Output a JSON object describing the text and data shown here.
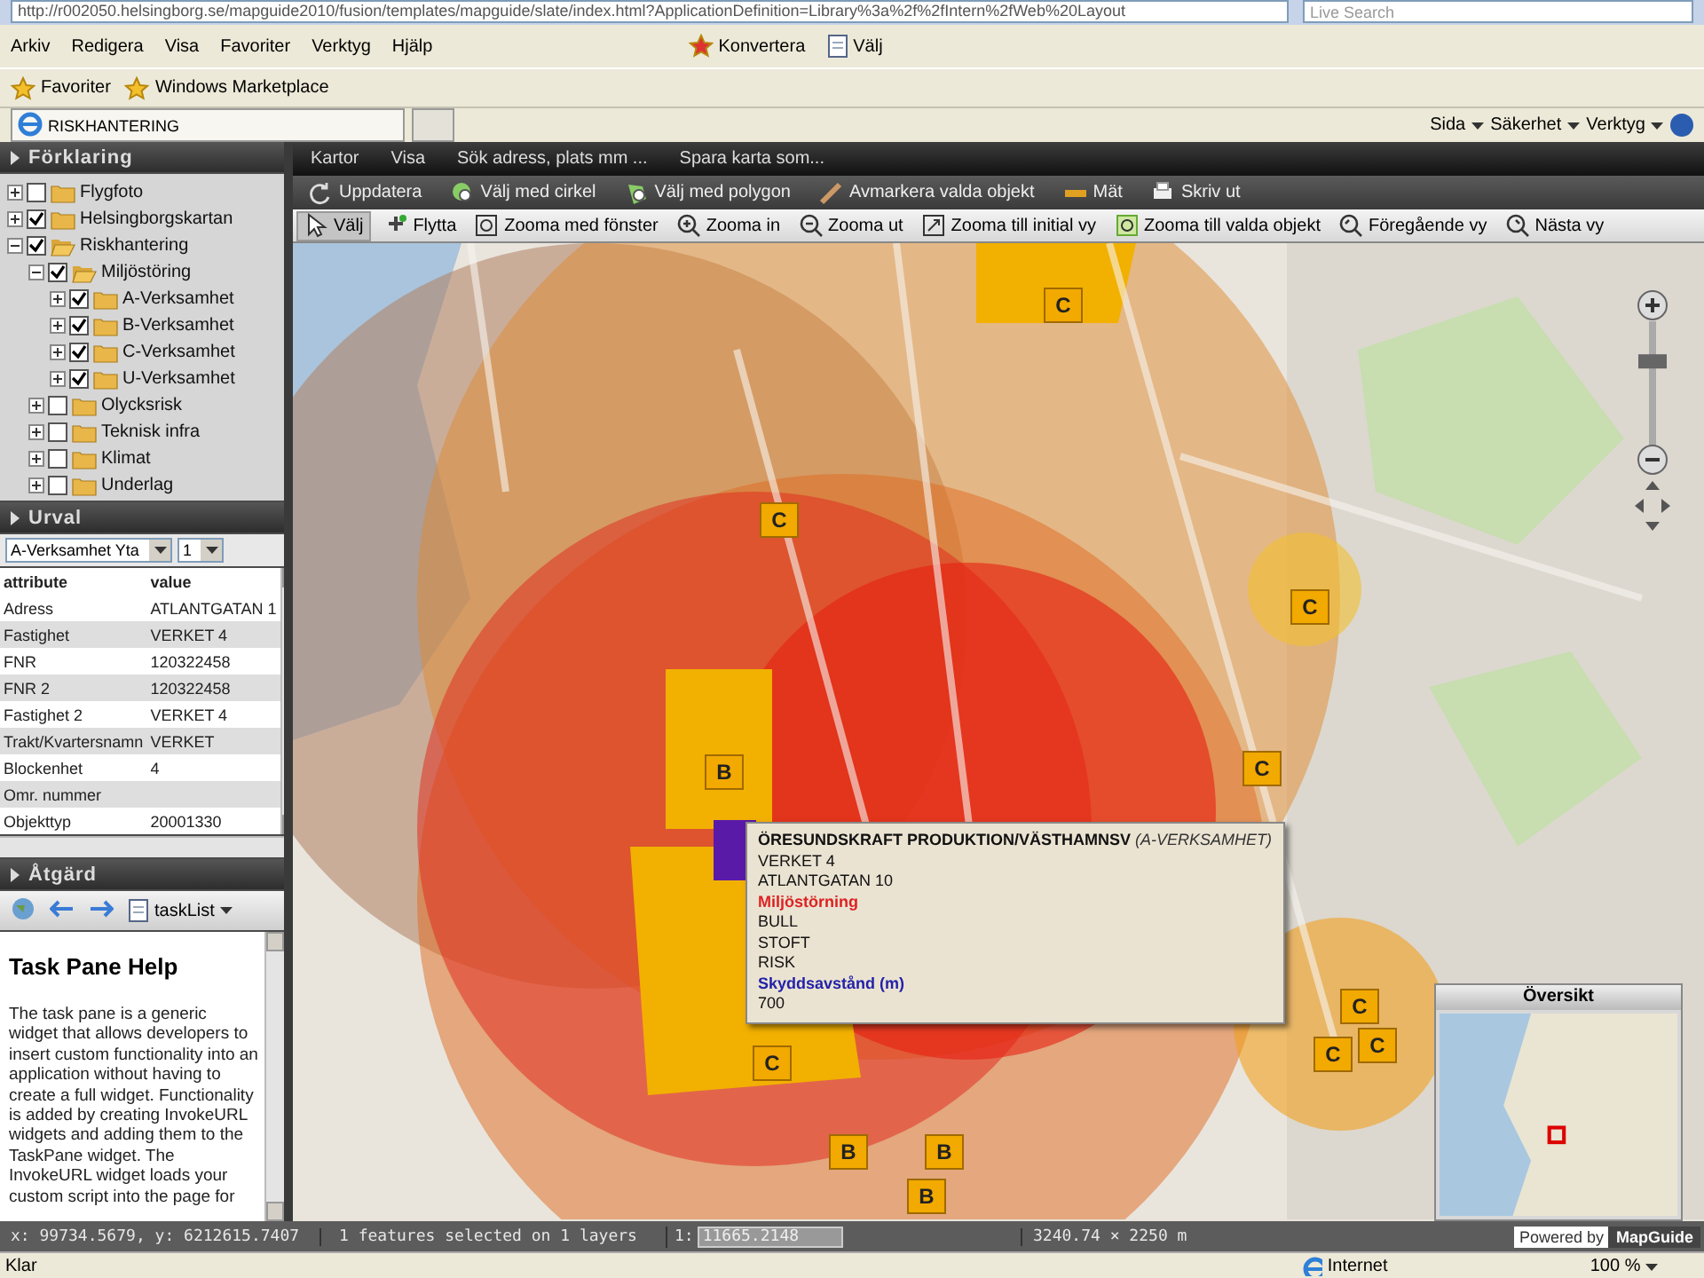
{
  "browser": {
    "address": "http://r002050.helsingborg.se/mapguide2010/fusion/templates/mapguide/slate/index.html?ApplicationDefinition=Library%3a%2f%2fIntern%2fWeb%20Layout",
    "search_placeholder": "Live Search",
    "menu": [
      "Arkiv",
      "Redigera",
      "Visa",
      "Favoriter",
      "Verktyg",
      "Hjälp"
    ],
    "tools": [
      "Konvertera",
      "Välj"
    ],
    "favorites": [
      "Favoriter",
      "Windows Marketplace"
    ],
    "tab": "RISKHANTERING",
    "commands": [
      "Sida",
      "Säkerhet",
      "Verktyg"
    ]
  },
  "legend": {
    "title": "Förklaring",
    "tree": [
      {
        "label": "Flygfoto",
        "checked": false,
        "expanded": false
      },
      {
        "label": "Helsingborgskartan",
        "checked": true,
        "expanded": false
      },
      {
        "label": "Riskhantering",
        "checked": true,
        "expanded": true,
        "children": [
          {
            "label": "Miljöstöring",
            "checked": true,
            "expanded": true,
            "children": [
              {
                "label": "A-Verksamhet",
                "checked": true,
                "expanded": false
              },
              {
                "label": "B-Verksamhet",
                "checked": true,
                "expanded": false
              },
              {
                "label": "C-Verksamhet",
                "checked": true,
                "expanded": false
              },
              {
                "label": "U-Verksamhet",
                "checked": true,
                "expanded": false
              }
            ]
          },
          {
            "label": "Olycksrisk",
            "checked": false,
            "expanded": false
          },
          {
            "label": "Teknisk infra",
            "checked": false,
            "expanded": false
          },
          {
            "label": "Klimat",
            "checked": false,
            "expanded": false
          },
          {
            "label": "Underlag",
            "checked": false,
            "expanded": false
          }
        ]
      }
    ]
  },
  "selection": {
    "title": "Urval",
    "layer": "A-Verksamhet Yta",
    "page": "1",
    "columns": [
      "attribute",
      "value"
    ],
    "rows": [
      [
        "Adress",
        "ATLANTGATAN 1"
      ],
      [
        "Fastighet",
        "VERKET 4"
      ],
      [
        "FNR",
        "120322458"
      ],
      [
        "FNR 2",
        "120322458"
      ],
      [
        "Fastighet 2",
        "VERKET 4"
      ],
      [
        "Trakt/Kvartersnamn",
        "VERKET"
      ],
      [
        "Blockenhet",
        "4"
      ],
      [
        "Omr. nummer",
        ""
      ],
      [
        "Objekttyp",
        "20001330"
      ]
    ]
  },
  "task": {
    "title": "Åtgärd",
    "list": "taskList",
    "heading": "Task Pane Help",
    "body": "The task pane is a generic widget that allows developers to insert custom functionality into an application without having to create a full widget. Functionality is added by creating InvokeURL widgets and adding them to the TaskPane widget. The InvokeURL widget loads your custom script into the page for"
  },
  "coordinates": "x: 99734.5679, y: 6212615.7407",
  "menubar": [
    "Kartor",
    "Visa",
    "Sök adress, plats mm ...",
    "Spara karta som..."
  ],
  "toolbar_1": [
    "Uppdatera",
    "Välj med cirkel",
    "Välj med polygon",
    "Avmarkera valda objekt",
    "Mät",
    "Skriv ut"
  ],
  "toolbar_2": [
    {
      "label": "Välj",
      "selected": true
    },
    {
      "label": "Flytta",
      "selected": false
    },
    {
      "label": "Zooma med fönster",
      "selected": false
    },
    {
      "label": "Zooma in",
      "selected": false
    },
    {
      "label": "Zooma ut",
      "selected": false
    },
    {
      "label": "Zooma till initial vy",
      "selected": false
    },
    {
      "label": "Zooma till valda objekt",
      "selected": false
    },
    {
      "label": "Föregående vy",
      "selected": false
    },
    {
      "label": "Nästa vy",
      "selected": false
    }
  ],
  "map": {
    "markers": [
      "C",
      "C",
      "C",
      "B",
      "C",
      "C",
      "B",
      "B",
      "B",
      "C",
      "C",
      "C"
    ],
    "popup": {
      "title": "ÖRESUNDSKRAFT PRODUKTION/VÄSTHAMNSV",
      "category": "(A-VERKSAMHET)",
      "lines": [
        {
          "kind": "text",
          "text": "VERKET 4"
        },
        {
          "kind": "text",
          "text": "ATLANTGATAN 10"
        },
        {
          "kind": "alert",
          "text": "Miljöstörning"
        },
        {
          "kind": "text",
          "text": "BULL"
        },
        {
          "kind": "text",
          "text": "STOFT"
        },
        {
          "kind": "text",
          "text": "RISK"
        },
        {
          "kind": "info",
          "text": "Skyddsavstånd (m)"
        },
        {
          "kind": "text",
          "text": "700"
        }
      ]
    },
    "zoom": {
      "level": 0.7
    },
    "overview": {
      "title": "Översikt"
    }
  },
  "status": {
    "selection": "1 features selected on 1 layers",
    "scale_prefix": "1:",
    "scale": "11665.2148",
    "size": "3240.74 × 2250 m",
    "powered": "Powered by",
    "brand": "MapGuide"
  },
  "browser_status": {
    "text": "Klar",
    "zone": "Internet",
    "zoom": "100 %"
  }
}
